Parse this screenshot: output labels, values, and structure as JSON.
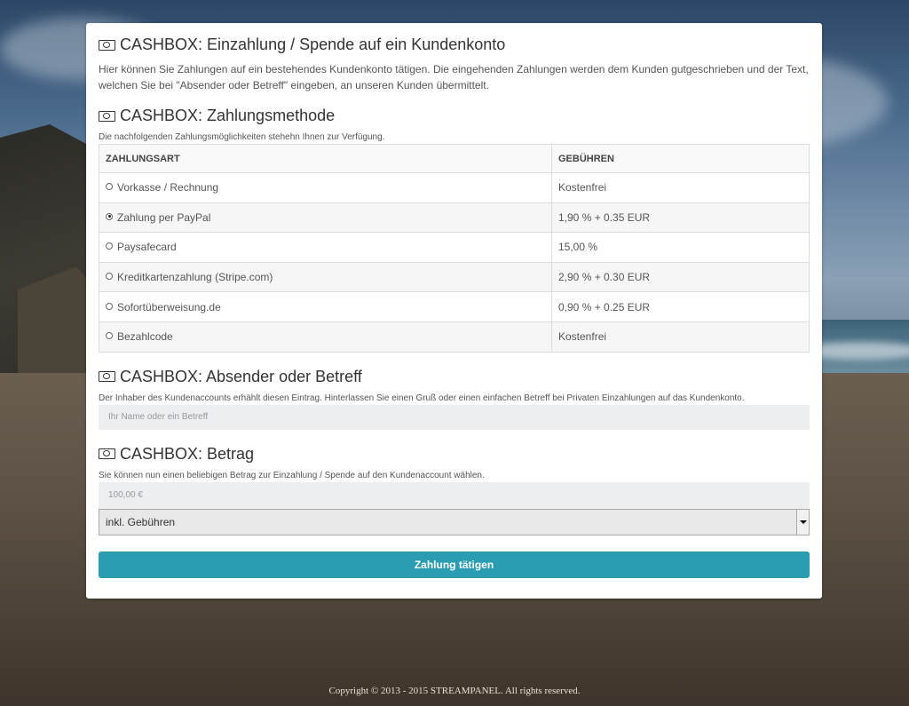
{
  "header": {
    "title": "CASHBOX: Einzahlung / Spende auf ein Kundenkonto",
    "intro": "Hier können Sie Zahlungen auf ein bestehendes Kundenkonto tätigen. Die eingehenden Zahlungen werden dem Kunden gutgeschrieben und der Text, welchen Sie bei \"Absender oder Betreff\" eingeben, an unseren Kunden übermittelt."
  },
  "payment_method": {
    "title": "CASHBOX: Zahlungsmethode",
    "description": "Die nachfolgenden Zahlungsmöglichkeiten stehehn Ihnen zur Verfügung.",
    "columns": [
      "ZAHLUNGSART",
      "GEBÜHREN"
    ],
    "rows": [
      {
        "label": "Vorkasse / Rechnung",
        "fee": "Kostenfrei",
        "selected": false
      },
      {
        "label": "Zahlung per PayPal",
        "fee": "1,90 % + 0.35 EUR",
        "selected": true
      },
      {
        "label": "Paysafecard",
        "fee": "15,00 %",
        "selected": false
      },
      {
        "label": "Kreditkartenzahlung (Stripe.com)",
        "fee": "2,90 % + 0.30 EUR",
        "selected": false
      },
      {
        "label": "Sofortüberweisung.de",
        "fee": "0,90 % + 0.25 EUR",
        "selected": false
      },
      {
        "label": "Bezahlcode",
        "fee": "Kostenfrei",
        "selected": false
      }
    ]
  },
  "sender": {
    "title": "CASHBOX: Absender oder Betreff",
    "description": "Der Inhaber des Kundenaccounts erhählt diesen Eintrag. Hinterlassen Sie einen Gruß oder einen einfachen Betreff bei Privaten Einzahlungen auf das Kundenkonto.",
    "placeholder": "Ihr Name oder ein Betreff"
  },
  "amount": {
    "title": "CASHBOX: Betrag",
    "description": "Sie können nun einen beliebigen Betrag zur Einzahlung / Spende auf den Kundenaccount wählen.",
    "placeholder": "100,00 €",
    "fee_option": "inkl. Gebühren"
  },
  "submit_label": "Zahlung tätigen",
  "footer": "Copyright © 2013 - 2015 STREAMPANEL. All rights reserved."
}
